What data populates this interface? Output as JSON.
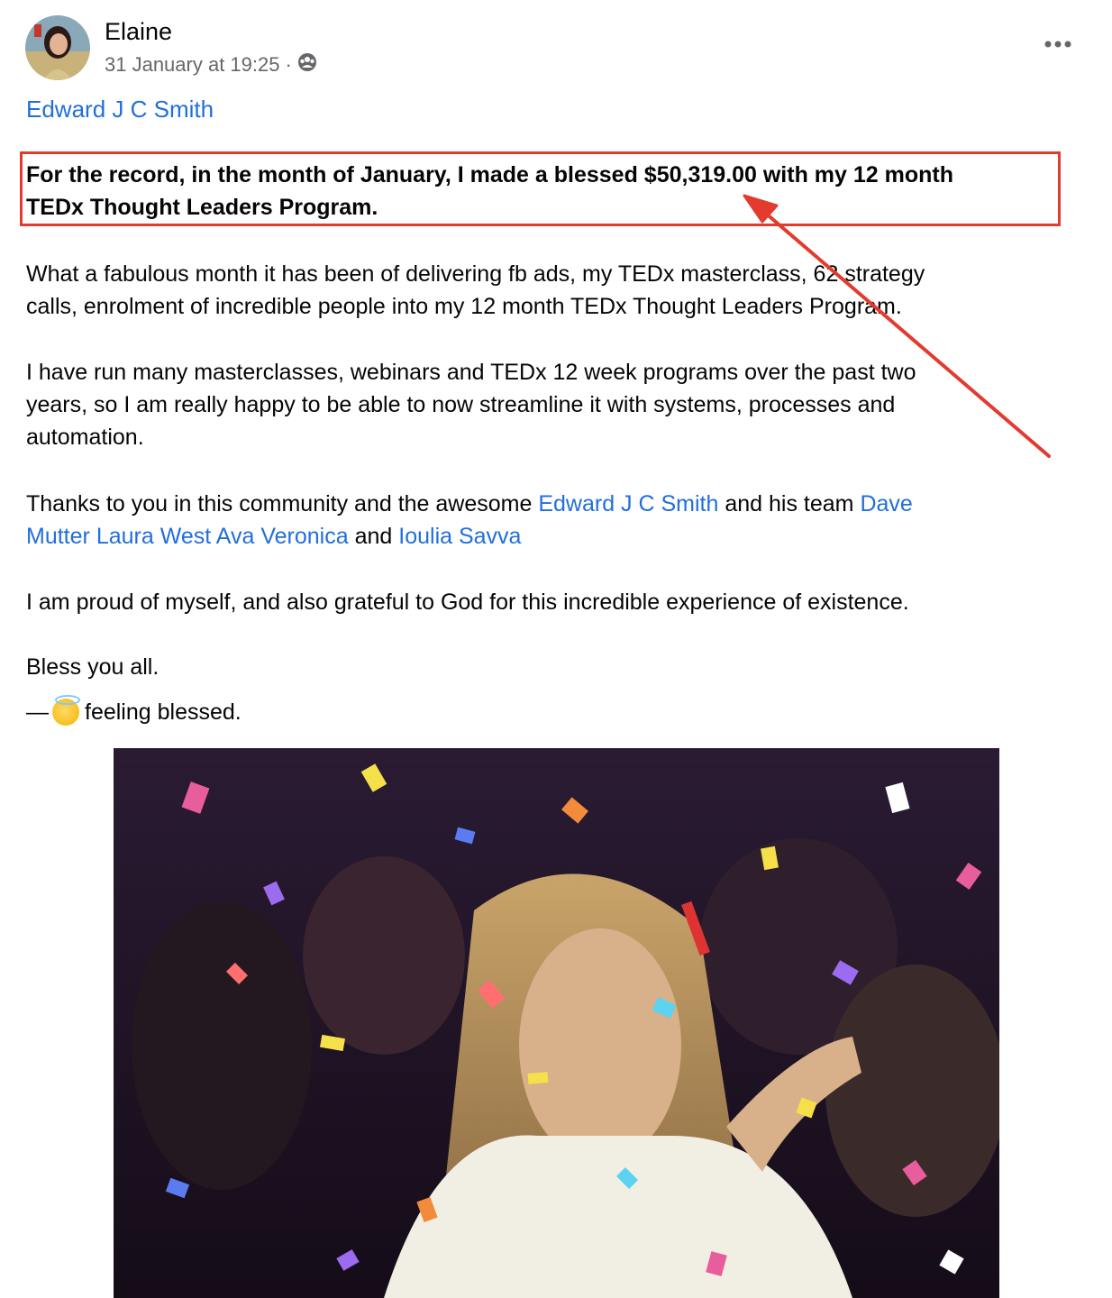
{
  "post": {
    "author": "Elaine",
    "timestamp": "31 January at 19:25",
    "separator": "·",
    "privacy_icon": "group-icon",
    "more_icon": "more-options-icon",
    "tagged": "Edward J C Smith"
  },
  "body": {
    "highlight": {
      "line1": "For the record, in the month of January, I made a blessed $50,319.00 with my 12 month",
      "line2": "TEDx Thought Leaders Program."
    },
    "para2": {
      "line1": "What a fabulous month it has been of delivering fb ads, my TEDx masterclass, 62 strategy",
      "line2": "calls, enrolment of incredible people into my 12 month TEDx Thought Leaders Program."
    },
    "para3": {
      "line1": "I have run many masterclasses, webinars and TEDx 12 week programs over the past two",
      "line2": "years, so I am really happy to be able to now streamline it with systems, processes and",
      "line3": "automation."
    },
    "para4": {
      "pre": "Thanks to you in this community and the awesome ",
      "mention1": "Edward J C Smith",
      "mid1": " and his team ",
      "mention2a": "Dave",
      "mention2b": "Mutter",
      "mention3": "Laura West",
      "mention4": "Ava Veronica",
      "mid2": " and ",
      "mention5": "Ioulia Savva"
    },
    "para5": "I am proud of myself, and also grateful to God for this incredible experience of existence.",
    "para6": "Bless you all.",
    "feeling": {
      "dash": "—",
      "emoji_name": "halo-smiley-icon",
      "text": "feeling blessed."
    }
  },
  "annotation": {
    "box_color": "#e33b2e",
    "arrow_color": "#e33b2e"
  },
  "colors": {
    "link": "#216fdb",
    "meta": "#65676b"
  }
}
